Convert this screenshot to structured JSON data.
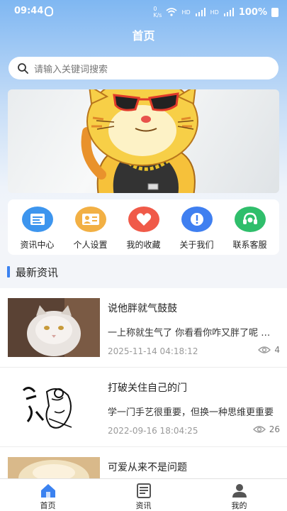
{
  "status_bar": {
    "time": "09:44",
    "net_speed": "0\nK/s",
    "hd1": "HD",
    "sig1": "4G",
    "hd2": "HD",
    "sig2": "4G",
    "battery": "100%"
  },
  "header": {
    "title": "首页"
  },
  "search": {
    "placeholder": "请输入关键词搜索"
  },
  "menu": [
    {
      "label": "资讯中心",
      "icon": "news-icon",
      "color": "#3d95ee"
    },
    {
      "label": "个人设置",
      "icon": "profile-card-icon",
      "color": "#f2b044"
    },
    {
      "label": "我的收藏",
      "icon": "heart-icon",
      "color": "#f05a49"
    },
    {
      "label": "关于我们",
      "icon": "info-icon",
      "color": "#3f7ff0"
    },
    {
      "label": "联系客服",
      "icon": "headset-icon",
      "color": "#2fbe6b"
    }
  ],
  "section": {
    "title": "最新资讯"
  },
  "news": [
    {
      "title": "说他胖就气鼓鼓",
      "summary": "一上称就生气了 你看看你咋又胖了呢 奶凶奶凶的",
      "date": "2025-11-14 04:18:12",
      "views": "4"
    },
    {
      "title": "打破关住自己的门",
      "summary": "学一门手艺很重要，但换一种思维更重要",
      "date": "2022-09-16 18:04:25",
      "views": "26"
    },
    {
      "title": "可爱从来不是问题",
      "summary": "",
      "date": "",
      "views": ""
    }
  ],
  "tabs": [
    {
      "label": "首页",
      "icon": "home-icon",
      "active": true
    },
    {
      "label": "资讯",
      "icon": "document-icon",
      "active": false
    },
    {
      "label": "我的",
      "icon": "user-icon",
      "active": false
    }
  ],
  "colors": {
    "accent": "#3b82f0"
  }
}
